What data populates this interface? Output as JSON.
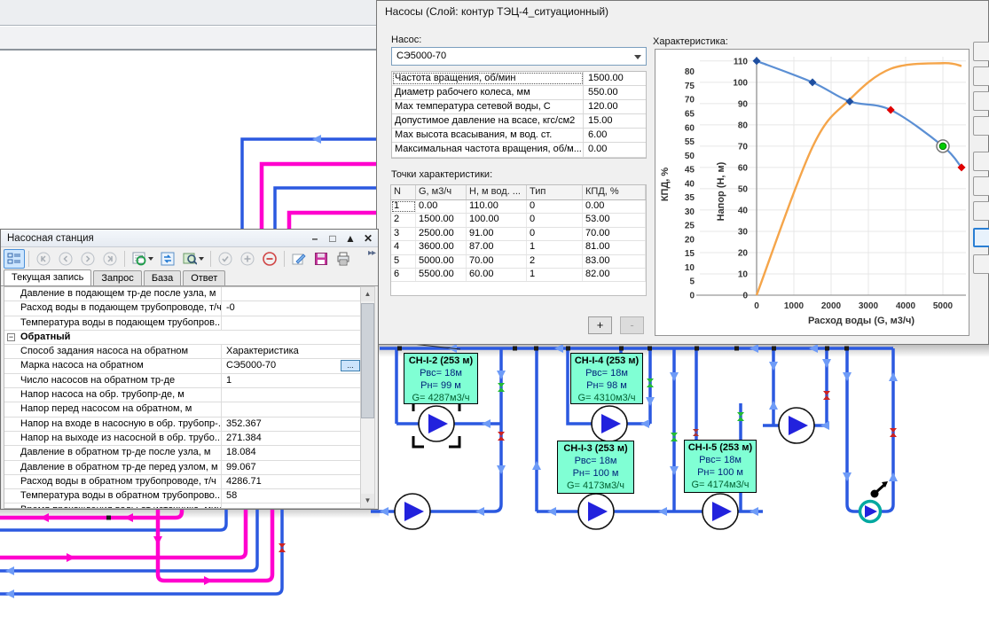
{
  "pump_dialog": {
    "title": "Насосы (Слой: контур ТЭЦ-4_ситуационный)",
    "pump_label": "Насос:",
    "pump_select": "СЭ5000-70",
    "properties": [
      {
        "label": "Частота вращения, об/мин",
        "value": "1500.00"
      },
      {
        "label": "Диаметр рабочего колеса, мм",
        "value": "550.00"
      },
      {
        "label": "Мах температура сетевой воды, С",
        "value": "120.00"
      },
      {
        "label": "Допустимое давление на всасе, кгс/см2",
        "value": "15.00"
      },
      {
        "label": "Мах высота всасывания, м вод. ст.",
        "value": "6.00"
      },
      {
        "label": "Максимальная частота вращения, об/м...",
        "value": "0.00"
      }
    ],
    "points_label": "Точки характеристики:",
    "points_table": {
      "columns": [
        "N",
        "G, м3/ч",
        "Н, м вод. ...",
        "Тип",
        "КПД, %"
      ],
      "rows": [
        [
          "1",
          "0.00",
          "110.00",
          "0",
          "0.00"
        ],
        [
          "2",
          "1500.00",
          "100.00",
          "0",
          "53.00"
        ],
        [
          "3",
          "2500.00",
          "91.00",
          "0",
          "70.00"
        ],
        [
          "4",
          "3600.00",
          "87.00",
          "1",
          "81.00"
        ],
        [
          "5",
          "5000.00",
          "70.00",
          "2",
          "83.00"
        ],
        [
          "6",
          "5500.00",
          "60.00",
          "1",
          "82.00"
        ]
      ]
    },
    "add_button": "+",
    "remove_button": "-",
    "chart_label": "Характеристика:"
  },
  "chart_data": {
    "type": "line",
    "title": "Характеристика",
    "x": [
      0,
      1500,
      2500,
      3600,
      5000,
      5500
    ],
    "series": [
      {
        "name": "Напор",
        "values": [
          110,
          100,
          91,
          87,
          70,
          60
        ],
        "color": "#5b8fd4",
        "axis": "H",
        "marker_types": [
          0,
          0,
          0,
          1,
          2,
          1
        ]
      },
      {
        "name": "КПД",
        "values": [
          0,
          53,
          70,
          81,
          83,
          82
        ],
        "color": "#f5a54a",
        "axis": "KPD"
      }
    ],
    "marker_colors": {
      "0": "#1f4fa0",
      "1": "#e00000",
      "2": "#00cc00"
    },
    "xlabel": "Расход воды (G, м3/ч)",
    "ylabel_outer": "КПД, %",
    "ylabel_inner": "Напор (Н, м)",
    "x_ticks": [
      0,
      1000,
      2000,
      3000,
      4000,
      5000
    ],
    "h_axis": {
      "min": 0,
      "max": 112,
      "tick_step": 10,
      "tick_max": 110
    },
    "kpd_axis": {
      "min": 0,
      "max": 85.3,
      "tick_step": 5,
      "tick_max": 80
    },
    "grid": true,
    "legend": "none"
  },
  "station_dialog": {
    "title": "Насосная станция",
    "window_buttons": [
      "–",
      "□",
      "▲",
      "✕"
    ],
    "tabs": [
      "Текущая запись",
      "Запрос",
      "База",
      "Ответ"
    ],
    "rows": [
      {
        "label": "Давление в подающем тр-де после узла, м",
        "value": ""
      },
      {
        "label": "Расход воды в подающем трубопроводе, т/ч",
        "value": "-0"
      },
      {
        "label": "Температура воды в подающем трубопров...",
        "value": ""
      },
      {
        "label": "Обратный",
        "value": "",
        "type": "group"
      },
      {
        "label": "Способ задания насоса на обратном",
        "value": "Характеристика"
      },
      {
        "label": "Марка насоса на обратном",
        "value": "СЭ5000-70",
        "selected": true
      },
      {
        "label": "Число насосов на обратном тр-де",
        "value": "1"
      },
      {
        "label": "Напор насоса на обр. трубопр-де, м",
        "value": ""
      },
      {
        "label": "Напор перед насосом на обратном, м",
        "value": ""
      },
      {
        "label": "Напор на входе в насосную в обр. трубопр-...",
        "value": "352.367"
      },
      {
        "label": "Напор на выходе из насосной в обр. трубо...",
        "value": "271.384"
      },
      {
        "label": "Давление в обратном тр-де после узла, м",
        "value": "18.084"
      },
      {
        "label": "Давление в обратном тр-де перед узлом, м",
        "value": "99.067"
      },
      {
        "label": "Расход воды в обратном трубопроводе, т/ч",
        "value": "4286.71"
      },
      {
        "label": "Температура воды в обратном трубопрово...",
        "value": "58"
      },
      {
        "label": "Время прохождения воды от источника, мин",
        "value": "",
        "cut": true
      }
    ]
  },
  "network": {
    "pump_labels": [
      {
        "name": "СН-I-2 (253 м)",
        "lines": [
          "Рвс= 18м",
          "Рн= 99 м",
          "G= 4287м3/ч"
        ]
      },
      {
        "name": "СН-I-4 (253 м)",
        "lines": [
          "Рвс= 18м",
          "Рн= 98 м",
          "G= 4310м3/ч"
        ]
      },
      {
        "name": "СН-I-3 (253 м)",
        "lines": [
          "Рвс= 18м",
          "Рн= 100 м",
          "G= 4173м3/ч"
        ]
      },
      {
        "name": "СН-I-5 (253 м)",
        "lines": [
          "Рвс= 18м",
          "Рн= 100 м",
          "G= 4174м3/ч"
        ]
      }
    ],
    "colors": {
      "supply": "#ff00ce",
      "return": "#2b59e0",
      "label_bg": "#80ffd4",
      "valve_open": "#22bb33",
      "valve_closed": "#cc2222"
    }
  }
}
